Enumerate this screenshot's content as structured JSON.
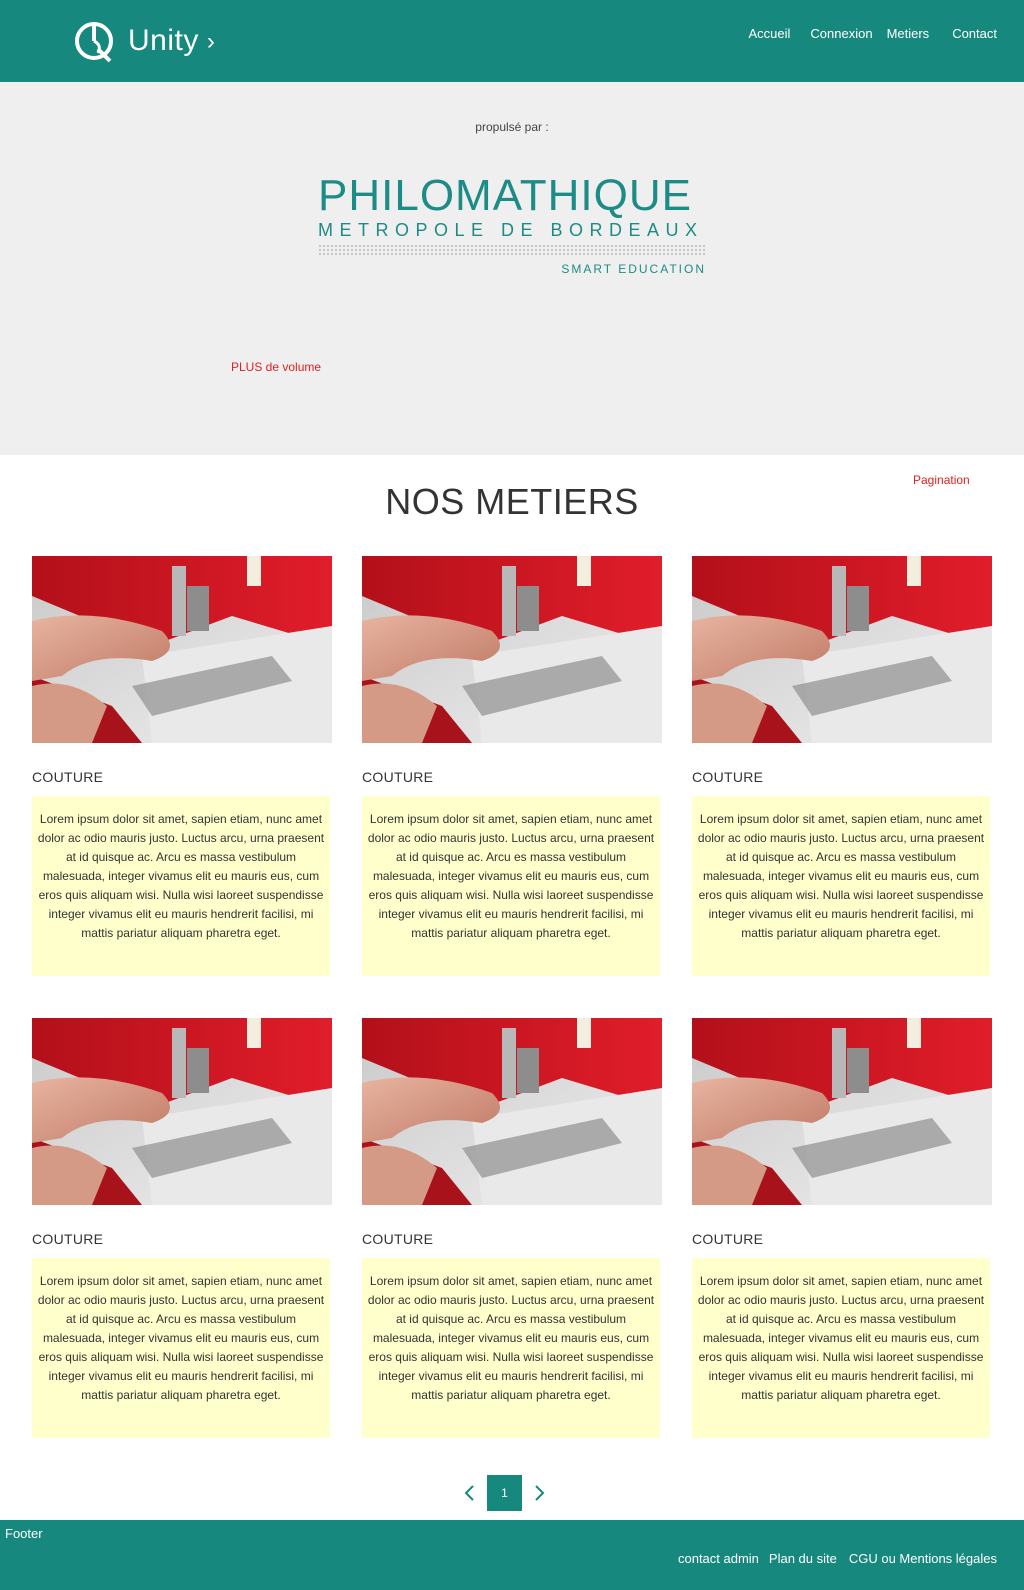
{
  "header": {
    "brand": "Unity",
    "nav": [
      "Accueil",
      "Connexion",
      "Metiers",
      "Contact"
    ]
  },
  "hero": {
    "powered_by": "propulsé par :",
    "partner_logo": {
      "main": "PHILOMATHIQUE",
      "sub": "METROPOLE DE BORDEAUX",
      "tagline": "SMART EDUCATION"
    },
    "more_volume": "PLUS de volume"
  },
  "section": {
    "pagination_label": "Pagination",
    "title": "NOS METIERS"
  },
  "cards": [
    {
      "title": "COUTURE",
      "image": "sewing-machine-photo",
      "description": "Lorem ipsum dolor sit amet, sapien etiam, nunc amet dolor ac odio mauris justo. Luctus arcu, urna praesent at id quisque ac. Arcu es massa vestibulum malesuada, integer vivamus elit eu mauris eus, cum eros quis aliquam wisi. Nulla wisi laoreet suspendisse integer vivamus elit eu mauris hendrerit facilisi, mi mattis pariatur aliquam pharetra eget."
    },
    {
      "title": "COUTURE",
      "image": "sewing-machine-photo",
      "description": "Lorem ipsum dolor sit amet, sapien etiam, nunc amet dolor ac odio mauris justo. Luctus arcu, urna praesent at id quisque ac. Arcu es massa vestibulum malesuada, integer vivamus elit eu mauris eus, cum eros quis aliquam wisi. Nulla wisi laoreet suspendisse integer vivamus elit eu mauris hendrerit facilisi, mi mattis pariatur aliquam pharetra eget."
    },
    {
      "title": "COUTURE",
      "image": "sewing-machine-photo",
      "description": "Lorem ipsum dolor sit amet, sapien etiam, nunc amet dolor ac odio mauris justo. Luctus arcu, urna praesent at id quisque ac. Arcu es massa vestibulum malesuada, integer vivamus elit eu mauris eus, cum eros quis aliquam wisi. Nulla wisi laoreet suspendisse integer vivamus elit eu mauris hendrerit facilisi, mi mattis pariatur aliquam pharetra eget."
    },
    {
      "title": "COUTURE",
      "image": "sewing-machine-photo",
      "description": "Lorem ipsum dolor sit amet, sapien etiam, nunc amet dolor ac odio mauris justo. Luctus arcu, urna praesent at id quisque ac. Arcu es massa vestibulum malesuada, integer vivamus elit eu mauris eus, cum eros quis aliquam wisi. Nulla wisi laoreet suspendisse integer vivamus elit eu mauris hendrerit facilisi, mi mattis pariatur aliquam pharetra eget."
    },
    {
      "title": "COUTURE",
      "image": "sewing-machine-photo",
      "description": "Lorem ipsum dolor sit amet, sapien etiam, nunc amet dolor ac odio mauris justo. Luctus arcu, urna praesent at id quisque ac. Arcu es massa vestibulum malesuada, integer vivamus elit eu mauris eus, cum eros quis aliquam wisi. Nulla wisi laoreet suspendisse integer vivamus elit eu mauris hendrerit facilisi, mi mattis pariatur aliquam pharetra eget."
    },
    {
      "title": "COUTURE",
      "image": "sewing-machine-photo",
      "description": "Lorem ipsum dolor sit amet, sapien etiam, nunc amet dolor ac odio mauris justo. Luctus arcu, urna praesent at id quisque ac. Arcu es massa vestibulum malesuada, integer vivamus elit eu mauris eus, cum eros quis aliquam wisi. Nulla wisi laoreet suspendisse integer vivamus elit eu mauris hendrerit facilisi, mi mattis pariatur aliquam pharetra eget."
    }
  ],
  "pager": {
    "current_page": "1",
    "prev_icon": "chevron-left-icon",
    "next_icon": "chevron-right-icon"
  },
  "footer": {
    "label": "Footer",
    "links": [
      "contact admin",
      "Plan du site",
      "CGU ou Mentions légales"
    ]
  },
  "colors": {
    "primary": "#17887e",
    "brand_teal": "#1e8c86",
    "hero_bg": "#efefef",
    "accent_red": "#e02020",
    "card_desc_bg": "#ffffcc"
  }
}
